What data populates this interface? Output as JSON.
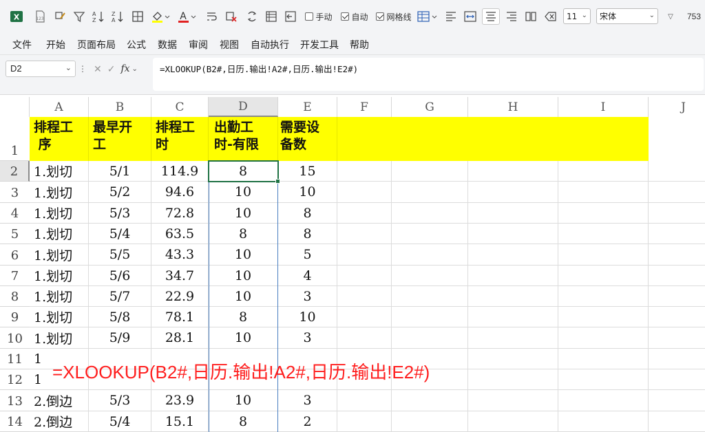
{
  "toolbar": {
    "manual_label": "手动",
    "auto_label": "自动",
    "gridlines_label": "网格线",
    "font_size": "11",
    "font_name": "宋体",
    "zoom_partial": "753"
  },
  "menu": [
    "文件",
    "开始",
    "页面布局",
    "公式",
    "数据",
    "审阅",
    "视图",
    "自动执行",
    "开发工具",
    "帮助"
  ],
  "formula_bar": {
    "name_box": "D2",
    "fx": "fx",
    "formula": "=XLOOKUP(B2#,日历.输出!A2#,日历.输出!E2#)"
  },
  "sheet": {
    "columns": [
      "A",
      "B",
      "C",
      "D",
      "E",
      "F",
      "G",
      "H",
      "I",
      "J"
    ],
    "row_numbers": [
      "1",
      "2",
      "3",
      "4",
      "5",
      "6",
      "7",
      "8",
      "9",
      "10",
      "11",
      "12",
      "13",
      "14"
    ],
    "headers": [
      "排程工\n 序",
      "最早开\n工",
      "排程工\n时",
      "出勤工\n时-有限",
      "需要设\n备数"
    ],
    "rows": [
      [
        "1.划切",
        "5/1",
        "114.9",
        "8",
        "15"
      ],
      [
        "1.划切",
        "5/2",
        "94.6",
        "10",
        "10"
      ],
      [
        "1.划切",
        "5/3",
        "72.8",
        "10",
        "8"
      ],
      [
        "1.划切",
        "5/4",
        "63.5",
        "8",
        "8"
      ],
      [
        "1.划切",
        "5/5",
        "43.3",
        "10",
        "5"
      ],
      [
        "1.划切",
        "5/6",
        "34.7",
        "10",
        "4"
      ],
      [
        "1.划切",
        "5/7",
        "22.9",
        "10",
        "3"
      ],
      [
        "1.划切",
        "5/8",
        "78.1",
        "8",
        "10"
      ],
      [
        "1.划切",
        "5/9",
        "28.1",
        "10",
        "3"
      ],
      [
        "1",
        "",
        "",
        "",
        ""
      ],
      [
        "1",
        "",
        "",
        "",
        ""
      ],
      [
        "2.倒边",
        "5/3",
        "23.9",
        "10",
        "3"
      ],
      [
        "2.倒边",
        "5/4",
        "15.1",
        "8",
        "2"
      ]
    ]
  },
  "annotation": "=XLOOKUP(B2#,日历.输出!A2#,日历.输出!E2#)",
  "colors": {
    "header_fill": "#ffff00",
    "annotation": "#ff1e1e",
    "selection": "#1f7244"
  }
}
